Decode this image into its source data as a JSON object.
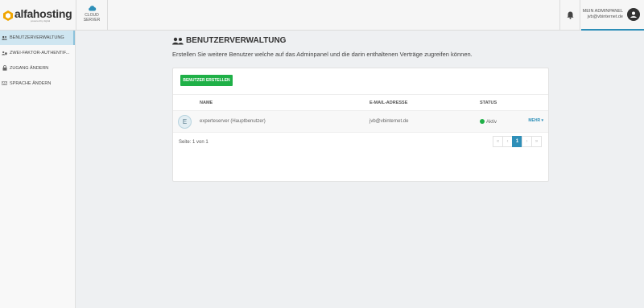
{
  "brand": {
    "logo_text": "alfahosting",
    "logo_subtext": "powered by digital",
    "colors": {
      "accent": "#2e8fb8",
      "success": "#1fb047"
    }
  },
  "header": {
    "product_tab": {
      "line1": "CLOUD",
      "line2": "SERVER",
      "icon": "cloud-icon"
    },
    "notifications_icon": "bell-icon",
    "account": {
      "title": "MEIN ADMINPANEL",
      "email": "jvb@vbinternet.de",
      "icon": "user-circle-icon"
    }
  },
  "sidebar": {
    "items": [
      {
        "label": "BENUTZERVERWALTUNG",
        "icon": "users-icon",
        "active": true
      },
      {
        "label": "ZWEI-FAKTOR-AUTHENTIF...",
        "icon": "user-shield-icon",
        "active": false
      },
      {
        "label": "ZUGANG ÄNDERN",
        "icon": "lock-icon",
        "active": false
      },
      {
        "label": "SPRACHE ÄNDERN",
        "icon": "keyboard-icon",
        "active": false
      }
    ]
  },
  "main": {
    "title": "BENUTZERVERWALTUNG",
    "title_icon": "users-icon",
    "description": "Erstellen Sie weitere Benutzer welche auf das Adminpanel und die darin enthaltenen Verträge zugreifen können.",
    "create_button": "BENUTZER ERSTELLEN",
    "table": {
      "columns": [
        "NAME",
        "E-MAIL-ADRESSE",
        "STATUS"
      ],
      "rows": [
        {
          "initial": "E",
          "name": "experteserver (Hauptbenutzer)",
          "email": "jvb@vbinternet.de",
          "status": "Aktiv",
          "action": "MEHR ▾"
        }
      ]
    },
    "pagination": {
      "label": "Seite: 1 von 1",
      "first": "«",
      "prev": "‹",
      "current": "1",
      "next": "›",
      "last": "»"
    }
  }
}
